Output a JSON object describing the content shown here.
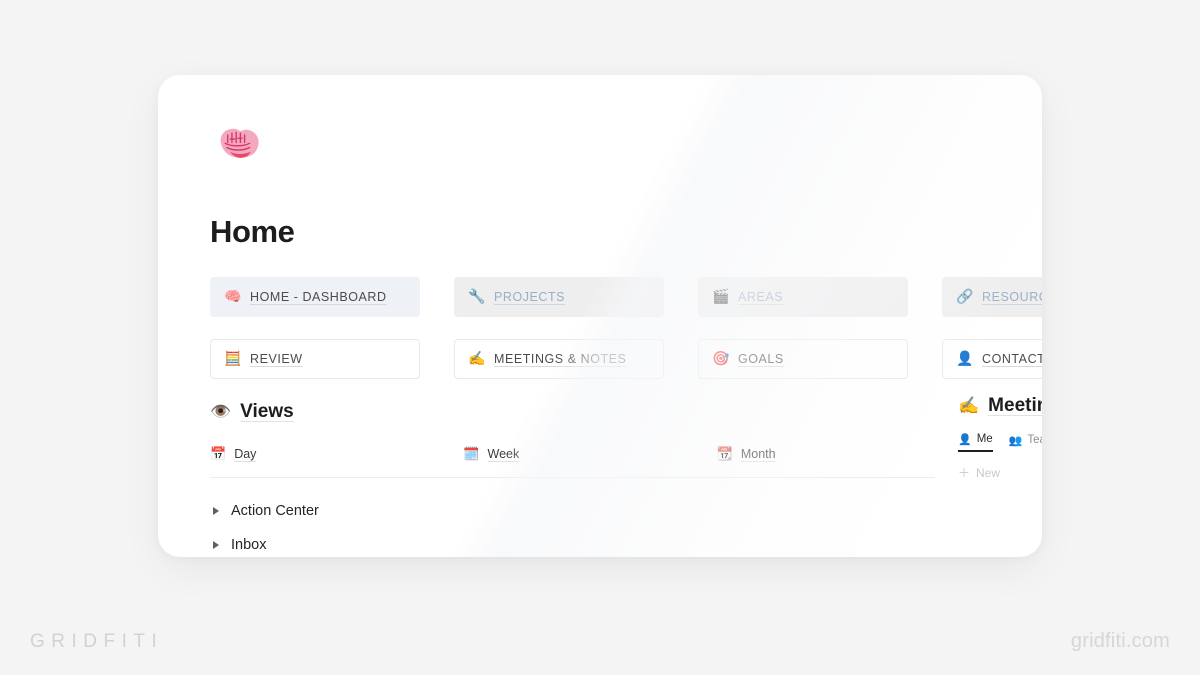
{
  "watermarks": {
    "brand": "GRIDFITI",
    "site": "gridfiti.com"
  },
  "page": {
    "icon": "brain-emoji",
    "title": "Home"
  },
  "nav_cards": [
    {
      "label": "HOME - DASHBOARD",
      "icon": "brain-emoji",
      "style": "tint-blue",
      "linked": false
    },
    {
      "label": "PROJECTS",
      "icon": "wrench-emoji",
      "style": "tint-grey",
      "linked": true
    },
    {
      "label": "AREAS",
      "icon": "clapper-emoji",
      "style": "tint-grey",
      "linked": true
    },
    {
      "label": "RESOURCES",
      "icon": "paperclip-emoji",
      "style": "tint-grey",
      "linked": true
    },
    {
      "label": "REVIEW",
      "icon": "abacus-emoji",
      "style": "outline",
      "linked": false
    },
    {
      "label": "MEETINGS & NOTES",
      "icon": "pencil-emoji",
      "style": "outline",
      "linked": false
    },
    {
      "label": "GOALS",
      "icon": "target-emoji",
      "style": "outline",
      "linked": false
    },
    {
      "label": "CONTACTS",
      "icon": "person-emoji",
      "style": "outline",
      "linked": false
    }
  ],
  "views": {
    "heading": "Views",
    "heading_icon": "eye-emoji",
    "items": [
      {
        "label": "Day",
        "icon": "calendar-emoji"
      },
      {
        "label": "Week",
        "icon": "calendar-emoji"
      },
      {
        "label": "Month",
        "icon": "calendar-emoji"
      }
    ]
  },
  "toggles": [
    {
      "label": "Action Center"
    },
    {
      "label": "Inbox"
    }
  ],
  "meetings_rail": {
    "heading": "Meetin",
    "heading_icon": "pencil-emoji",
    "tabs": [
      {
        "label": "Me",
        "icon": "person-icon",
        "active": true
      },
      {
        "label": "Team",
        "icon": "people-icon",
        "active": false
      }
    ],
    "new_label": "New",
    "new_icon": "plus-icon"
  },
  "colors": {
    "page_bg": "#f4f4f4",
    "window_bg": "#ffffff",
    "card_tint_blue": "#eef1f6",
    "card_tint_grey": "#eeeeee",
    "link_text": "#9aaec4",
    "body_text": "#4b4b4b",
    "heading_text": "#1d1d1d"
  }
}
